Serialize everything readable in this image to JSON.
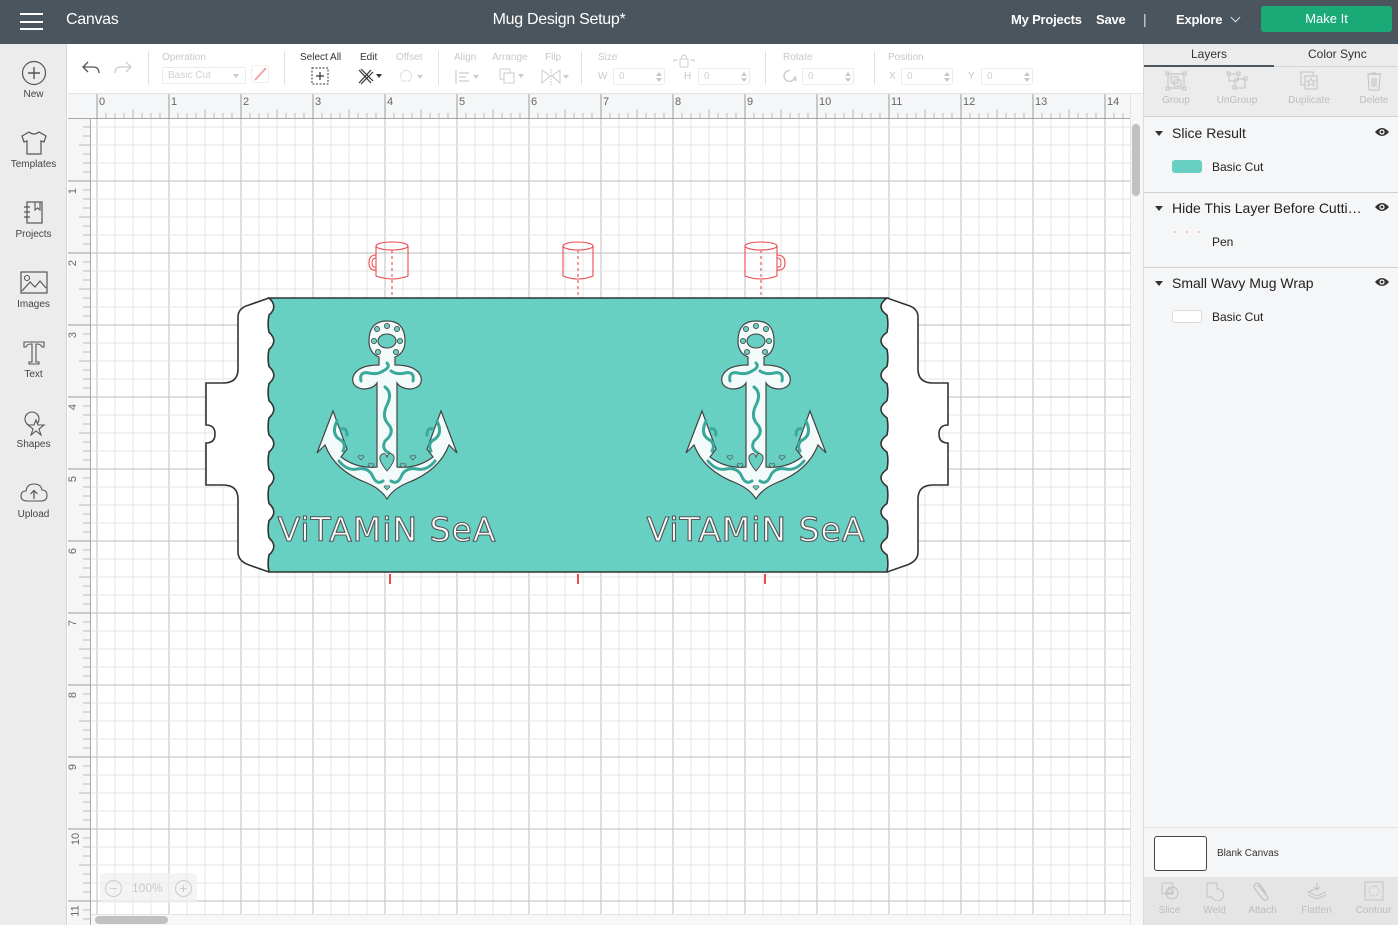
{
  "header": {
    "app_title": "Canvas",
    "document_title": "Mug Design Setup*",
    "my_projects": "My Projects",
    "save": "Save",
    "separator": "|",
    "explore": "Explore",
    "make_it": "Make It",
    "make_it_color": "#1aaa78",
    "bar_color": "#4b555e"
  },
  "sidebar": {
    "items": [
      {
        "label": "New",
        "icon": "plus-circle-icon"
      },
      {
        "label": "Templates",
        "icon": "tshirt-icon"
      },
      {
        "label": "Projects",
        "icon": "notebook-icon"
      },
      {
        "label": "Images",
        "icon": "image-icon"
      },
      {
        "label": "Text",
        "icon": "text-t-icon"
      },
      {
        "label": "Shapes",
        "icon": "shapes-icon"
      },
      {
        "label": "Upload",
        "icon": "cloud-upload-icon"
      }
    ]
  },
  "toolbar": {
    "operation_label": "Operation",
    "operation_value": "Basic Cut",
    "select_all_label": "Select All",
    "edit_label": "Edit",
    "offset_label": "Offset",
    "align_label": "Align",
    "arrange_label": "Arrange",
    "flip_label": "Flip",
    "size_label": "Size",
    "w_label": "W",
    "w_value": "0",
    "h_label": "H",
    "h_value": "0",
    "rotate_label": "Rotate",
    "rotate_value": "0",
    "position_label": "Position",
    "x_label": "X",
    "x_value": "0",
    "y_label": "Y",
    "y_value": "0"
  },
  "rulers": {
    "horizontal": [
      "0",
      "1",
      "2",
      "3",
      "4",
      "5",
      "6",
      "7",
      "8",
      "9",
      "10",
      "11",
      "12",
      "13",
      "14"
    ],
    "vertical": [
      "1",
      "2",
      "3",
      "4",
      "5",
      "6",
      "7",
      "8",
      "9",
      "10",
      "11"
    ],
    "unit": "in"
  },
  "canvas": {
    "zoom": "100%",
    "wrap_color": "#68cfc3",
    "guide_color": "#ec4a4f",
    "design_text": "ViTAMiN SeA",
    "design_text_2": "ViTAMiN SeA"
  },
  "panel": {
    "tabs": [
      {
        "label": "Layers"
      },
      {
        "label": "Color Sync"
      }
    ],
    "active_tab": "Layers",
    "layer_tools": [
      {
        "label": "Group"
      },
      {
        "label": "UnGroup"
      },
      {
        "label": "Duplicate"
      },
      {
        "label": "Delete"
      }
    ],
    "groups": [
      {
        "name": "Slice Result",
        "sub_label": "Basic Cut",
        "visible": true,
        "thumb_color": "#68cfc3"
      },
      {
        "name": "Hide This Layer Before Cutti…",
        "sub_label": "Pen",
        "visible": true,
        "thumb_color": "#f4b9bb"
      },
      {
        "name": "Small Wavy Mug Wrap",
        "sub_label": "Basic Cut",
        "visible": true,
        "thumb_color": "#ffffff"
      }
    ],
    "blank_canvas": "Blank Canvas",
    "bottom_tools": [
      {
        "label": "Slice"
      },
      {
        "label": "Weld"
      },
      {
        "label": "Attach"
      },
      {
        "label": "Flatten"
      },
      {
        "label": "Contour"
      }
    ]
  }
}
